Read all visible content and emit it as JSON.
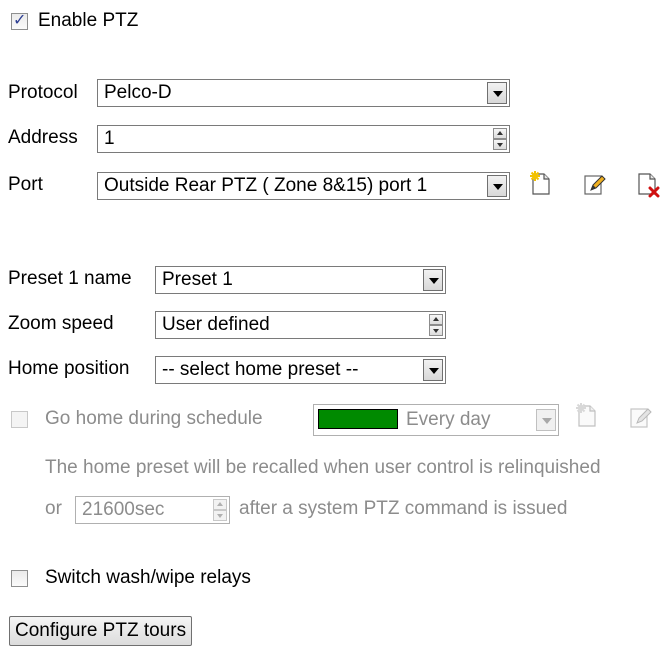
{
  "enable_ptz": {
    "label": "Enable PTZ",
    "checked": true
  },
  "protocol": {
    "label": "Protocol",
    "value": "Pelco-D"
  },
  "address": {
    "label": "Address",
    "value": "1"
  },
  "port": {
    "label": "Port",
    "value": "Outside Rear PTZ ( Zone 8&15) port 1"
  },
  "preset_name": {
    "label": "Preset 1 name",
    "value": "Preset 1"
  },
  "zoom_speed": {
    "label": "Zoom speed",
    "value": "User defined"
  },
  "home_position": {
    "label": "Home position",
    "value": "-- select home preset --"
  },
  "go_home": {
    "label": "Go home during schedule",
    "checked": false,
    "schedule_value": "Every day",
    "schedule_color": "#008a00",
    "note": "The home preset will be recalled when user control is relinquished",
    "or_label": "or",
    "timeout_value": "21600sec",
    "after_label": "after a system PTZ command is issued"
  },
  "wash_wipe": {
    "label": "Switch wash/wipe relays",
    "checked": false
  },
  "configure_tours": {
    "label": "Configure PTZ tours"
  },
  "icons": [
    "new-document-icon",
    "edit-pencil-icon",
    "delete-document-icon"
  ]
}
